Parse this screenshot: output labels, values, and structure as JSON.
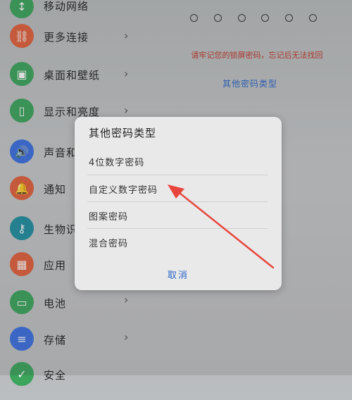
{
  "settings": {
    "items": [
      {
        "label": "移动网络",
        "icon": "network-icon",
        "color": "#3ba55c"
      },
      {
        "label": "更多连接",
        "icon": "link-icon",
        "color": "#e2603b"
      },
      {
        "label": "桌面和壁纸",
        "icon": "wallpaper-icon",
        "color": "#3ba55c"
      },
      {
        "label": "显示和亮度",
        "icon": "display-icon",
        "color": "#3ba55c"
      },
      {
        "label": "声音和振动",
        "icon": "sound-icon",
        "color": "#3b6fe2"
      },
      {
        "label": "通知",
        "icon": "bell-icon",
        "color": "#e2603b"
      },
      {
        "label": "生物识别",
        "icon": "key-icon",
        "color": "#1f8fa0"
      },
      {
        "label": "应用",
        "icon": "apps-icon",
        "color": "#e2603b"
      },
      {
        "label": "电池",
        "icon": "battery-icon",
        "color": "#3ba55c"
      },
      {
        "label": "存储",
        "icon": "storage-icon",
        "color": "#3b6fe2"
      },
      {
        "label": "安全",
        "icon": "shield-icon",
        "color": "#3ba55c"
      }
    ]
  },
  "pin": {
    "hint": "请牢记您的锁屏密码，忘记后无法找回",
    "other_types_link": "其他密码类型"
  },
  "dialog": {
    "title": "其他密码类型",
    "options": [
      "4位数字密码",
      "自定义数字密码",
      "图案密码",
      "混合密码"
    ],
    "cancel": "取消"
  },
  "colors": {
    "accent_blue": "#2b66c8",
    "hint_red": "#c0392b",
    "annotation_arrow": "#e8453c"
  }
}
